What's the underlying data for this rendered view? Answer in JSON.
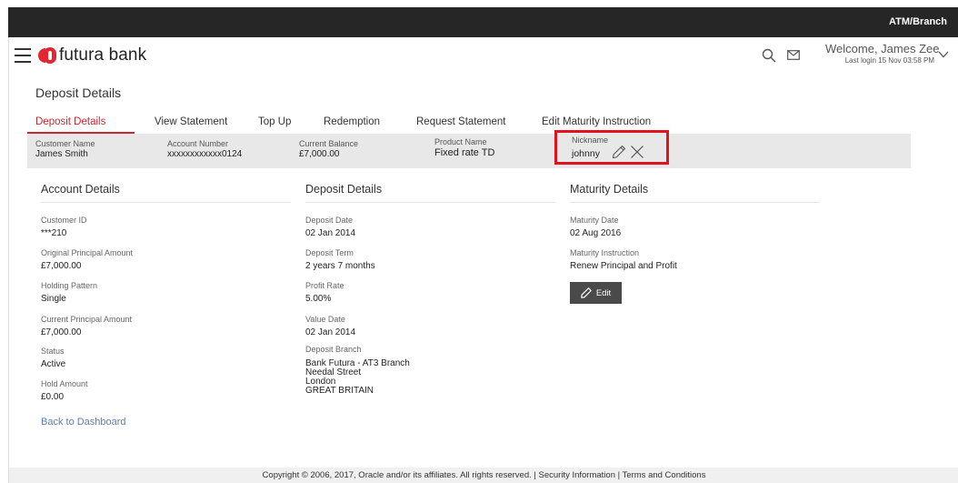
{
  "topbar": {
    "label": "ATM/Branch"
  },
  "header": {
    "brand": "futura bank",
    "welcome": "Welcome, James Zee",
    "last_login": "Last login 15 Nov 03:58 PM"
  },
  "page": {
    "title": "Deposit Details"
  },
  "tabs": [
    {
      "label": "Deposit Details"
    },
    {
      "label": "View Statement"
    },
    {
      "label": "Top Up"
    },
    {
      "label": "Redemption"
    },
    {
      "label": "Request Statement"
    },
    {
      "label": "Edit Maturity Instruction"
    }
  ],
  "summary": {
    "customer_name": {
      "label": "Customer Name",
      "value": "James Smith"
    },
    "account_number": {
      "label": "Account Number",
      "value": "xxxxxxxxxxxx0124"
    },
    "current_balance": {
      "label": "Current Balance",
      "value": "£7,000.00"
    },
    "product_name": {
      "label": "Product Name",
      "value": "Fixed rate TD"
    },
    "nickname": {
      "label": "Nickname",
      "value": "johnny"
    }
  },
  "account_details": {
    "title": "Account Details",
    "fields": [
      {
        "label": "Customer ID",
        "value": "***210"
      },
      {
        "label": "Original Principal Amount",
        "value": "£7,000.00"
      },
      {
        "label": "Holding Pattern",
        "value": "Single"
      },
      {
        "label": "Current Principal Amount",
        "value": "£7,000.00"
      },
      {
        "label": "Status",
        "value": "Active"
      },
      {
        "label": "Hold Amount",
        "value": "£0.00"
      }
    ]
  },
  "deposit_details": {
    "title": "Deposit Details",
    "fields": [
      {
        "label": "Deposit Date",
        "value": "02 Jan 2014"
      },
      {
        "label": "Deposit Term",
        "value": "2 years 7 months"
      },
      {
        "label": "Profit Rate",
        "value": "5.00%"
      },
      {
        "label": "Value Date",
        "value": "02 Jan 2014"
      },
      {
        "label": "Deposit Branch",
        "lines": [
          "Bank Futura - AT3 Branch",
          "Needal Street",
          "London",
          "GREAT BRITAIN"
        ]
      }
    ]
  },
  "maturity_details": {
    "title": "Maturity Details",
    "fields": [
      {
        "label": "Maturity Date",
        "value": "02 Aug 2016"
      },
      {
        "label": "Maturity Instruction",
        "value": "Renew Principal and Profit"
      }
    ],
    "edit_label": "Edit"
  },
  "back_link": "Back to Dashboard",
  "footer": {
    "copyright": "Copyright © 2006, 2017, Oracle and/or its affiliates. All rights reserved.",
    "separator": "|",
    "security": "Security Information",
    "terms": "Terms and Conditions"
  },
  "colors": {
    "accent": "#c8282f",
    "highlight": "#e0141e",
    "topbar": "#262626",
    "link": "#5b7eb6"
  },
  "icons": [
    "menu-icon",
    "search-icon",
    "mail-icon",
    "chevron-down-icon",
    "pencil-icon",
    "close-icon",
    "edit-pencil-icon"
  ]
}
